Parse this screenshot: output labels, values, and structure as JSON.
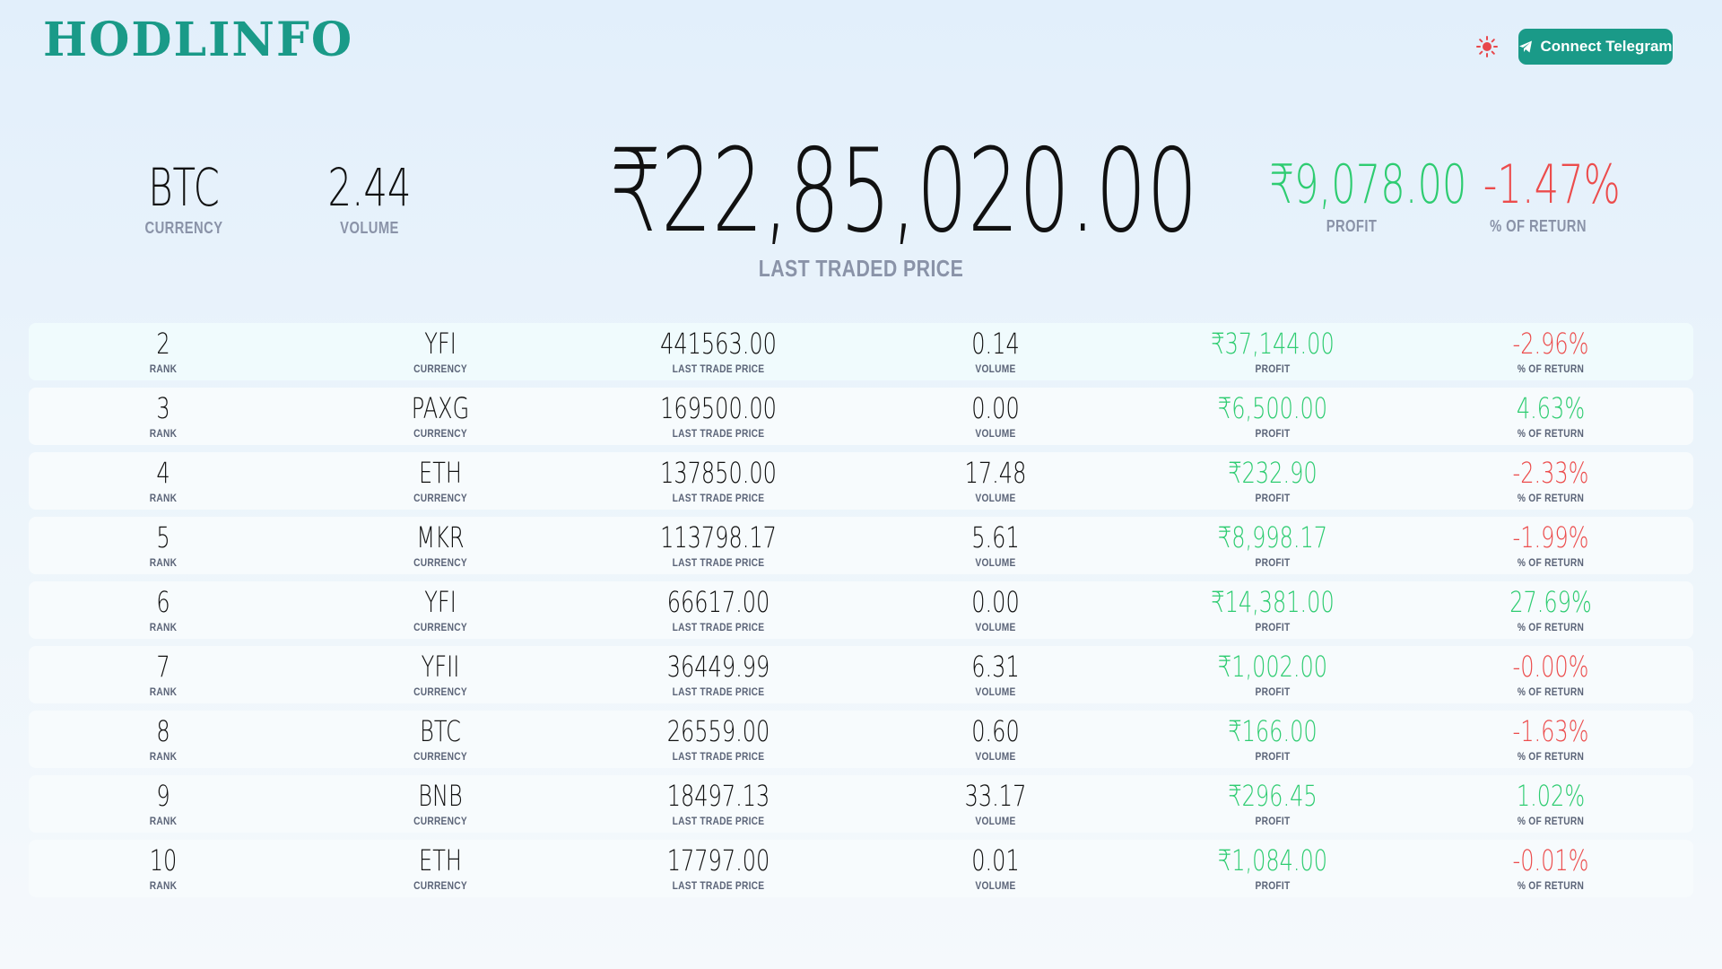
{
  "header": {
    "logo": "HODLINFO",
    "theme_icon": "sun-icon",
    "telegram_icon": "telegram-icon",
    "telegram_label": "Connect Telegram"
  },
  "colors": {
    "brand": "#1a9a88",
    "positive": "#2ecc71",
    "negative": "#ec4c4c"
  },
  "summary": {
    "currency": "BTC",
    "currency_label": "CURRENCY",
    "volume": "2.44",
    "volume_label": "VOLUME",
    "price": "₹22,85,020.00",
    "price_label": "LAST TRADED PRICE",
    "profit": "₹9,078.00",
    "profit_label": "PROFIT",
    "return": "-1.47%",
    "return_label": "% OF RETURN"
  },
  "labels": {
    "rank": "RANK",
    "currency": "CURRENCY",
    "last_trade_price": "LAST TRADE PRICE",
    "volume": "VOLUME",
    "profit": "PROFIT",
    "return": "% OF RETURN"
  },
  "rows": [
    {
      "rank": "2",
      "currency": "YFI",
      "price": "441563.00",
      "volume": "0.14",
      "profit": "₹37,144.00",
      "return": "-2.96%",
      "ret_sign": "neg"
    },
    {
      "rank": "3",
      "currency": "PAXG",
      "price": "169500.00",
      "volume": "0.00",
      "profit": "₹6,500.00",
      "return": "4.63%",
      "ret_sign": "pos"
    },
    {
      "rank": "4",
      "currency": "ETH",
      "price": "137850.00",
      "volume": "17.48",
      "profit": "₹232.90",
      "return": "-2.33%",
      "ret_sign": "neg"
    },
    {
      "rank": "5",
      "currency": "MKR",
      "price": "113798.17",
      "volume": "5.61",
      "profit": "₹8,998.17",
      "return": "-1.99%",
      "ret_sign": "neg"
    },
    {
      "rank": "6",
      "currency": "YFI",
      "price": "66617.00",
      "volume": "0.00",
      "profit": "₹14,381.00",
      "return": "27.69%",
      "ret_sign": "pos"
    },
    {
      "rank": "7",
      "currency": "YFII",
      "price": "36449.99",
      "volume": "6.31",
      "profit": "₹1,002.00",
      "return": "-0.00%",
      "ret_sign": "neg"
    },
    {
      "rank": "8",
      "currency": "BTC",
      "price": "26559.00",
      "volume": "0.60",
      "profit": "₹166.00",
      "return": "-1.63%",
      "ret_sign": "neg"
    },
    {
      "rank": "9",
      "currency": "BNB",
      "price": "18497.13",
      "volume": "33.17",
      "profit": "₹296.45",
      "return": "1.02%",
      "ret_sign": "pos"
    },
    {
      "rank": "10",
      "currency": "ETH",
      "price": "17797.00",
      "volume": "0.01",
      "profit": "₹1,084.00",
      "return": "-0.01%",
      "ret_sign": "neg"
    }
  ]
}
